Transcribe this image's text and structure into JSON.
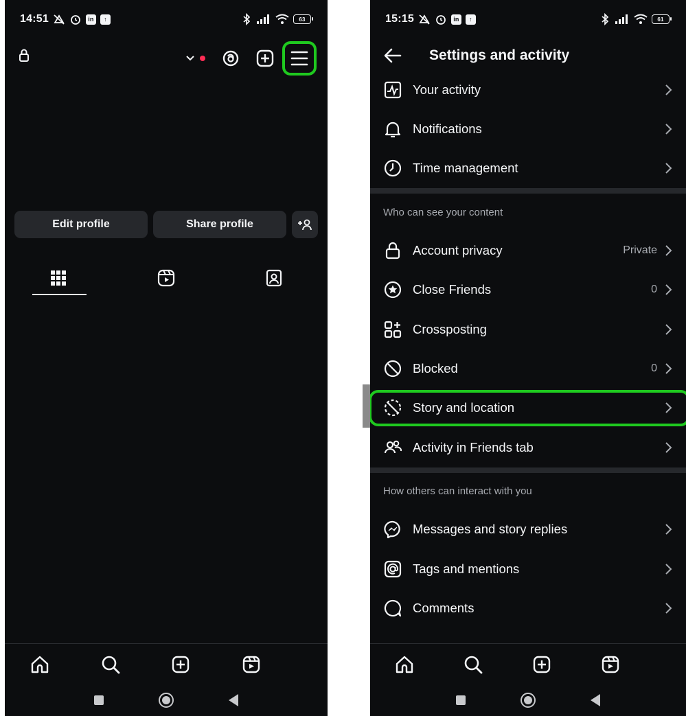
{
  "left": {
    "status": {
      "time": "14:51",
      "battery": "63"
    },
    "buttons": {
      "edit_profile": "Edit profile",
      "share_profile": "Share profile"
    },
    "icons": {
      "lock": "lock-icon",
      "account_switch": "chevron-down-icon",
      "threads": "threads-icon",
      "create": "plus-square-icon",
      "menu": "hamburger-menu-icon",
      "add_person": "add-person-icon",
      "grid_tab": "grid-icon",
      "reels_tab": "reels-icon",
      "tagged_tab": "tagged-person-icon"
    }
  },
  "right": {
    "status": {
      "time": "15:15",
      "battery": "61"
    },
    "title": "Settings and activity",
    "group1": [
      {
        "label": "Your activity",
        "icon": "activity-icon"
      },
      {
        "label": "Notifications",
        "icon": "bell-icon"
      },
      {
        "label": "Time management",
        "icon": "clock-icon"
      }
    ],
    "section_content": "Who can see your content",
    "group2": [
      {
        "label": "Account privacy",
        "value": "Private",
        "icon": "lock-icon"
      },
      {
        "label": "Close Friends",
        "value": "0",
        "icon": "star-circle-icon"
      },
      {
        "label": "Crossposting",
        "icon": "crossposting-icon"
      },
      {
        "label": "Blocked",
        "value": "0",
        "icon": "blocked-icon"
      },
      {
        "label": "Story and location",
        "icon": "story-location-icon"
      },
      {
        "label": "Activity in Friends tab",
        "icon": "friends-icon"
      }
    ],
    "section_interact": "How others can interact with you",
    "group3": [
      {
        "label": "Messages and story replies",
        "icon": "messenger-icon"
      },
      {
        "label": "Tags and mentions",
        "icon": "at-sign-icon"
      },
      {
        "label": "Comments",
        "icon": "comment-icon"
      }
    ]
  },
  "colors": {
    "background": "#0c0d0f",
    "highlight": "#1fc91f",
    "notification_dot": "#ff2d55"
  }
}
